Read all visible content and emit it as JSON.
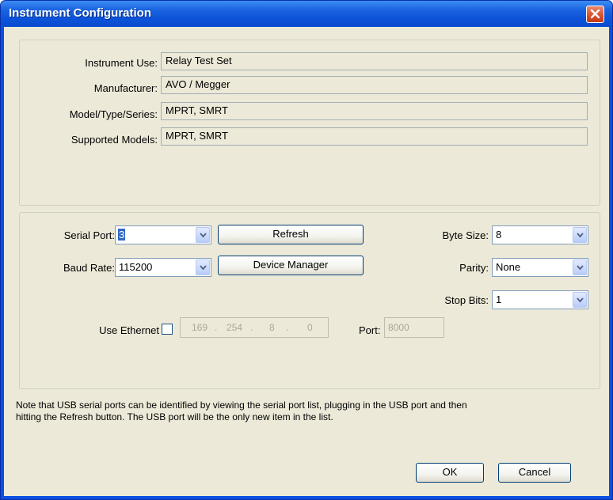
{
  "window": {
    "title": "Instrument Configuration"
  },
  "instrument": {
    "use_label": "Instrument Use:",
    "use_value": "Relay Test Set",
    "manufacturer_label": "Manufacturer:",
    "manufacturer_value": "AVO / Megger",
    "model_label": "Model/Type/Series:",
    "model_value": "MPRT, SMRT",
    "supported_label": "Supported Models:",
    "supported_value": "MPRT, SMRT"
  },
  "serial": {
    "port_label": "Serial Port:",
    "port_value": "3",
    "baud_label": "Baud Rate:",
    "baud_value": "115200",
    "refresh_label": "Refresh",
    "device_manager_label": "Device Manager",
    "byte_size_label": "Byte Size:",
    "byte_size_value": "8",
    "parity_label": "Parity:",
    "parity_value": "None",
    "stop_bits_label": "Stop Bits:",
    "stop_bits_value": "1"
  },
  "ethernet": {
    "use_label": "Use Ethernet",
    "checked": false,
    "ip_octets": [
      "169",
      "254",
      "8",
      "0"
    ],
    "port_label": "Port:",
    "port_value": "8000"
  },
  "note": {
    "line1": "Note that USB serial ports can be identified by viewing the serial port list, plugging in the USB port and then",
    "line2": "hitting the Refresh button.  The USB port will be the only new item in the list."
  },
  "buttons": {
    "ok_label": "OK",
    "cancel_label": "Cancel"
  },
  "colors": {
    "titlebar": "#0a4ee4",
    "dialog_bg": "#ece9d8",
    "close": "#d84e2a"
  }
}
